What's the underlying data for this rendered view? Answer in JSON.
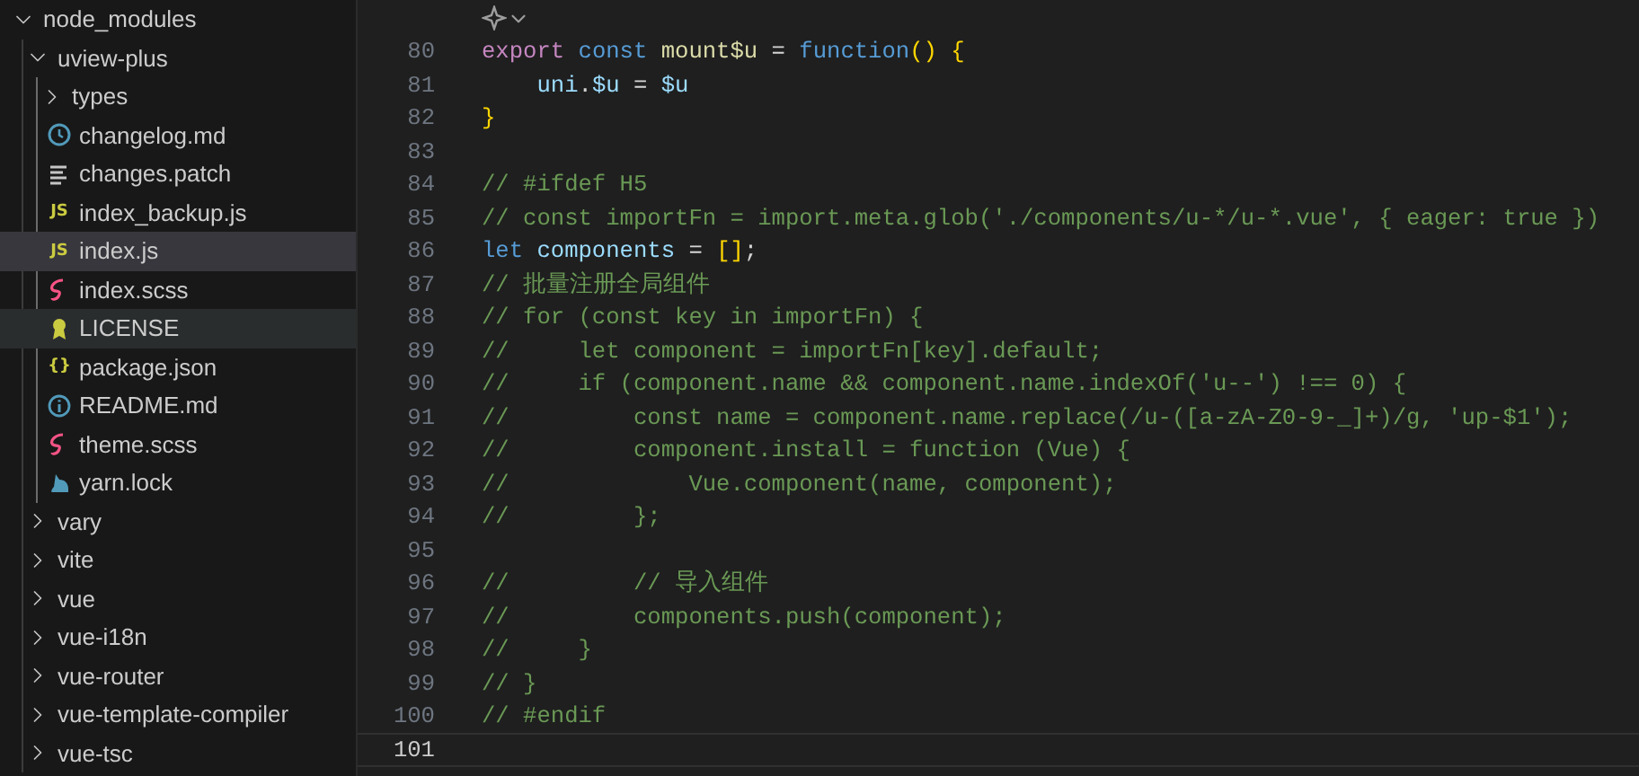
{
  "explorer": {
    "tree": [
      {
        "name": "node_modules",
        "kind": "folder",
        "expanded": true,
        "selected": false,
        "hovered": false,
        "children": [
          {
            "name": "uview-plus",
            "kind": "folder",
            "expanded": true,
            "selected": false,
            "hovered": false,
            "children": [
              {
                "name": "types",
                "kind": "folder",
                "expanded": false,
                "selected": false,
                "hovered": false
              },
              {
                "name": "changelog.md",
                "kind": "changelog",
                "selected": false,
                "hovered": false
              },
              {
                "name": "changes.patch",
                "kind": "patch",
                "selected": false,
                "hovered": false
              },
              {
                "name": "index_backup.js",
                "kind": "js",
                "badge": "JS",
                "selected": false,
                "hovered": false
              },
              {
                "name": "index.js",
                "kind": "js",
                "badge": "JS",
                "selected": true,
                "hovered": false
              },
              {
                "name": "index.scss",
                "kind": "sass",
                "selected": false,
                "hovered": false
              },
              {
                "name": "LICENSE",
                "kind": "license",
                "selected": false,
                "hovered": true
              },
              {
                "name": "package.json",
                "kind": "json",
                "badge": "{}",
                "selected": false,
                "hovered": false
              },
              {
                "name": "README.md",
                "kind": "readme",
                "selected": false,
                "hovered": false
              },
              {
                "name": "theme.scss",
                "kind": "sass",
                "selected": false,
                "hovered": false
              },
              {
                "name": "yarn.lock",
                "kind": "yarn",
                "selected": false,
                "hovered": false
              }
            ]
          },
          {
            "name": "vary",
            "kind": "folder",
            "expanded": false,
            "selected": false,
            "hovered": false
          },
          {
            "name": "vite",
            "kind": "folder",
            "expanded": false,
            "selected": false,
            "hovered": false
          },
          {
            "name": "vue",
            "kind": "folder",
            "expanded": false,
            "selected": false,
            "hovered": false
          },
          {
            "name": "vue-i18n",
            "kind": "folder",
            "expanded": false,
            "selected": false,
            "hovered": false
          },
          {
            "name": "vue-router",
            "kind": "folder",
            "expanded": false,
            "selected": false,
            "hovered": false
          },
          {
            "name": "vue-template-compiler",
            "kind": "folder",
            "expanded": false,
            "selected": false,
            "hovered": false
          },
          {
            "name": "vue-tsc",
            "kind": "folder",
            "expanded": false,
            "selected": false,
            "hovered": false
          }
        ]
      }
    ]
  },
  "editor": {
    "lines": [
      {
        "number": "80",
        "current": false,
        "tokens": [
          {
            "kind": "control",
            "text": "export "
          },
          {
            "kind": "keyword",
            "text": "const "
          },
          {
            "kind": "function",
            "text": "mount$u"
          },
          {
            "kind": "plain",
            "text": " = "
          },
          {
            "kind": "keyword",
            "text": "function"
          },
          {
            "kind": "bracket",
            "text": "() {"
          }
        ]
      },
      {
        "number": "81",
        "current": false,
        "tokens": [
          {
            "kind": "variable",
            "text": "    uni"
          },
          {
            "kind": "plain",
            "text": "."
          },
          {
            "kind": "variable",
            "text": "$u"
          },
          {
            "kind": "plain",
            "text": " = "
          },
          {
            "kind": "variable",
            "text": "$u"
          }
        ]
      },
      {
        "number": "82",
        "current": false,
        "tokens": [
          {
            "kind": "bracket",
            "text": "}"
          }
        ]
      },
      {
        "number": "83",
        "current": false
      },
      {
        "number": "84",
        "current": false,
        "tokens": [
          {
            "kind": "comment",
            "text": "// #ifdef H5"
          }
        ]
      },
      {
        "number": "85",
        "current": false,
        "tokens": [
          {
            "kind": "comment",
            "text": "// const importFn = import.meta.glob('./components/u-*/u-*.vue', { eager: true })"
          }
        ]
      },
      {
        "number": "86",
        "current": false,
        "tokens": [
          {
            "kind": "keyword",
            "text": "let "
          },
          {
            "kind": "variable",
            "text": "components"
          },
          {
            "kind": "plain",
            "text": " = "
          },
          {
            "kind": "bracket",
            "text": "[]"
          },
          {
            "kind": "plain",
            "text": ";"
          }
        ]
      },
      {
        "number": "87",
        "current": false,
        "tokens": [
          {
            "kind": "comment",
            "text": "// 批量注册全局组件"
          }
        ]
      },
      {
        "number": "88",
        "current": false,
        "tokens": [
          {
            "kind": "comment",
            "text": "// for (const key in importFn) {"
          }
        ]
      },
      {
        "number": "89",
        "current": false,
        "tokens": [
          {
            "kind": "comment",
            "text": "//     let component = importFn[key].default;"
          }
        ]
      },
      {
        "number": "90",
        "current": false,
        "tokens": [
          {
            "kind": "comment",
            "text": "//     if (component.name && component.name.indexOf('u--') !== 0) {"
          }
        ]
      },
      {
        "number": "91",
        "current": false,
        "tokens": [
          {
            "kind": "comment",
            "text": "//         const name = component.name.replace(/u-([a-zA-Z0-9-_]+)/g, 'up-$1');"
          }
        ]
      },
      {
        "number": "92",
        "current": false,
        "tokens": [
          {
            "kind": "comment",
            "text": "//         component.install = function (Vue) {"
          }
        ]
      },
      {
        "number": "93",
        "current": false,
        "tokens": [
          {
            "kind": "comment",
            "text": "//             Vue.component(name, component);"
          }
        ]
      },
      {
        "number": "94",
        "current": false,
        "tokens": [
          {
            "kind": "comment",
            "text": "//         };"
          }
        ]
      },
      {
        "number": "95",
        "current": false
      },
      {
        "number": "96",
        "current": false,
        "tokens": [
          {
            "kind": "comment",
            "text": "//         // 导入组件"
          }
        ]
      },
      {
        "number": "97",
        "current": false,
        "tokens": [
          {
            "kind": "comment",
            "text": "//         components.push(component);"
          }
        ]
      },
      {
        "number": "98",
        "current": false,
        "tokens": [
          {
            "kind": "comment",
            "text": "//     }"
          }
        ]
      },
      {
        "number": "99",
        "current": false,
        "tokens": [
          {
            "kind": "comment",
            "text": "// }"
          }
        ]
      },
      {
        "number": "100",
        "current": false,
        "tokens": [
          {
            "kind": "comment",
            "text": "// #endif"
          }
        ]
      },
      {
        "number": "101",
        "current": true
      }
    ]
  }
}
